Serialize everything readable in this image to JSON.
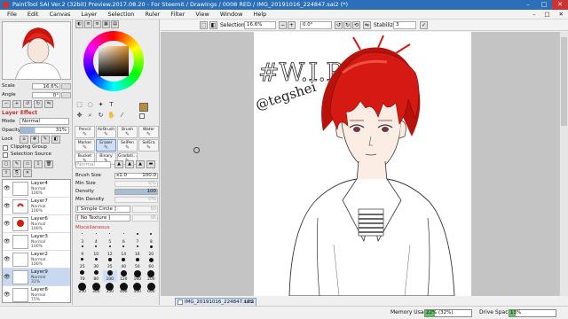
{
  "window": {
    "title": "PaintTool SAI Ver.2 (32bit) Preview.2017.08.20 - For Steemit / Drawings / 0008 RED / IMG_20191016_224847.sai2 (*)",
    "min": "–",
    "max": "□",
    "close": "✕"
  },
  "menu": {
    "items": [
      "File",
      "Edit",
      "Canvas",
      "Layer",
      "Selection",
      "Ruler",
      "Filter",
      "View",
      "Window",
      "Help"
    ],
    "right": [
      "–",
      "□",
      "✕"
    ]
  },
  "navigator": {
    "scale_label": "Scale",
    "scale_value": "16.6%",
    "angle_label": "Angle",
    "angle_value": "0°"
  },
  "layer_panel": {
    "section_title": "Layer Effect",
    "mode_label": "Mode",
    "mode_value": "Normal",
    "opacity_label": "Opacity",
    "opacity_value": "31%",
    "lock_label": "Lock",
    "clipping_group": "Clipping Group",
    "selection_source": "Selection Source",
    "layers": [
      {
        "name": "Layer4",
        "mode": "Normal",
        "opacity": "100%",
        "selected": false
      },
      {
        "name": "Layer7",
        "mode": "Normal",
        "opacity": "100%",
        "selected": false
      },
      {
        "name": "Layer6",
        "mode": "Normal",
        "opacity": "100%",
        "selected": false
      },
      {
        "name": "Layer3",
        "mode": "Normal",
        "opacity": "100%",
        "selected": false
      },
      {
        "name": "Layer2",
        "mode": "Normal",
        "opacity": "100%",
        "selected": false
      },
      {
        "name": "Layer9",
        "mode": "Normal",
        "opacity": "31%",
        "selected": true
      },
      {
        "name": "Layer8",
        "mode": "Normal",
        "opacity": "75%",
        "selected": false
      }
    ]
  },
  "tools": {
    "items": [
      {
        "label": "Pencil",
        "selected": false
      },
      {
        "label": "AirBrush",
        "selected": false
      },
      {
        "label": "Brush",
        "selected": false
      },
      {
        "label": "Water",
        "selected": false
      },
      {
        "label": "Marker",
        "selected": false
      },
      {
        "label": "Eraser",
        "selected": true
      },
      {
        "label": "SelPen",
        "selected": false
      },
      {
        "label": "SelEra",
        "selected": false
      },
      {
        "label": "Bucket",
        "selected": false
      },
      {
        "label": "Binary",
        "selected": false
      },
      {
        "label": "Gradati...",
        "selected": false
      }
    ],
    "blend_mode": "Normal",
    "brush_size_label": "Brush Size",
    "brush_size_mult": "x1.0",
    "brush_size_value": "100.0",
    "min_size_label": "Min Size",
    "min_size_value": "0%",
    "density_label": "Density",
    "density_value": "100",
    "min_density_label": "Min Density",
    "min_density_value": "0%",
    "shape_label": "[ Simple Circle ]",
    "shape_side": "50",
    "texture_label": "[ No Texture ]",
    "texture_side": "95",
    "misc_label": "Miscellaneous",
    "brush_sizes": [
      "3",
      "4",
      "5",
      "6",
      "7",
      "8",
      "9",
      "10",
      "12",
      "14",
      "16",
      "20",
      "25",
      "30",
      "35",
      "40",
      "50",
      "60",
      "70",
      "80",
      "100",
      "120",
      "160",
      "200",
      "250",
      "300",
      "350",
      "400",
      "500",
      "600"
    ],
    "selected_brush": "100"
  },
  "toolbar": {
    "selection_label": "Selection",
    "zoom_value": "16.6%",
    "angle_value": "0.0°",
    "stabilizer_label": "Stabilizer",
    "stabilizer_value": "3"
  },
  "canvas": {
    "doc_tab": "IMG_20191016_224847.sai2",
    "doc_zoom": "17%",
    "wip_text": "#W.I.P",
    "signature": "@tegshei"
  },
  "status": {
    "memory_label": "Memory Usage",
    "memory_value": "22% (32%)",
    "memory_fraction": 0.22,
    "drive_label": "Drive Space",
    "drive_value": "13%",
    "drive_fraction": 0.13
  },
  "colors": {
    "primary": "#b98b3f",
    "titlebar": "#2a6fb8",
    "hair_red": "#d41a12"
  }
}
